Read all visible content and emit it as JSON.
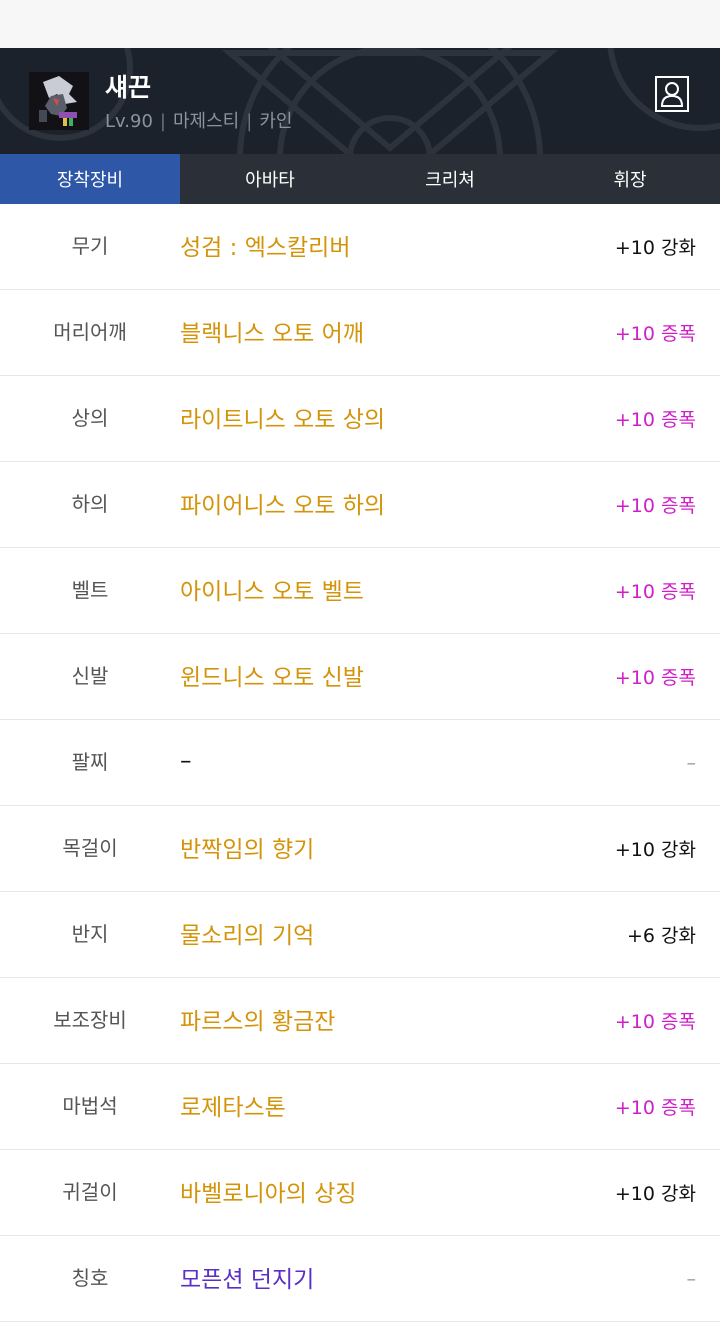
{
  "character": {
    "name": "섀끈",
    "level": "Lv.90",
    "job": "마제스티",
    "server": "카인",
    "profile_icon": "person-profile-icon"
  },
  "colors": {
    "tab_active": "#2e57a8",
    "item_name": "#d4940a",
    "title_name": "#5a2fc7",
    "amplify": "#d01fc8",
    "reinforce": "#111111"
  },
  "tabs": [
    {
      "label": "장착장비",
      "active": true
    },
    {
      "label": "아바타",
      "active": false
    },
    {
      "label": "크리쳐",
      "active": false
    },
    {
      "label": "휘장",
      "active": false
    }
  ],
  "equipment": [
    {
      "slot": "무기",
      "item": "성검 : 엑스칼리버",
      "enhance": "+10 강화",
      "type": "reinforce"
    },
    {
      "slot": "머리어깨",
      "item": "블랙니스 오토 어깨",
      "enhance": "+10 증폭",
      "type": "amplify"
    },
    {
      "slot": "상의",
      "item": "라이트니스 오토 상의",
      "enhance": "+10 증폭",
      "type": "amplify"
    },
    {
      "slot": "하의",
      "item": "파이어니스 오토 하의",
      "enhance": "+10 증폭",
      "type": "amplify"
    },
    {
      "slot": "벨트",
      "item": "아이니스 오토 벨트",
      "enhance": "+10 증폭",
      "type": "amplify"
    },
    {
      "slot": "신발",
      "item": "윈드니스 오토 신발",
      "enhance": "+10 증폭",
      "type": "amplify"
    },
    {
      "slot": "팔찌",
      "item": "–",
      "enhance": "–",
      "type": "none"
    },
    {
      "slot": "목걸이",
      "item": "반짝임의 향기",
      "enhance": "+10 강화",
      "type": "reinforce"
    },
    {
      "slot": "반지",
      "item": "물소리의 기억",
      "enhance": "+6 강화",
      "type": "reinforce"
    },
    {
      "slot": "보조장비",
      "item": "파르스의 황금잔",
      "enhance": "+10 증폭",
      "type": "amplify"
    },
    {
      "slot": "마법석",
      "item": "로제타스톤",
      "enhance": "+10 증폭",
      "type": "amplify"
    },
    {
      "slot": "귀걸이",
      "item": "바벨로니아의 상징",
      "enhance": "+10 강화",
      "type": "reinforce"
    },
    {
      "slot": "칭호",
      "item": "모픈션 던지기",
      "enhance": "–",
      "type": "title"
    }
  ]
}
